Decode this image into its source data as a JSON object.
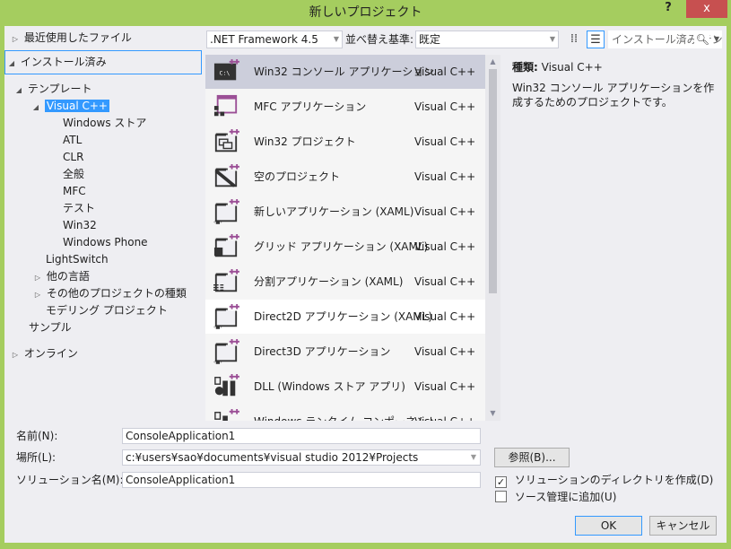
{
  "window": {
    "title": "新しいプロジェクト",
    "help_label": "?",
    "close_label": "x"
  },
  "tree": {
    "recent": "最近使用したファイル",
    "installed": "インストール済み",
    "templates": "テンプレート",
    "visual_cpp": "Visual C++",
    "cpp_children": [
      "Windows ストア",
      "ATL",
      "CLR",
      "全般",
      "MFC",
      "テスト",
      "Win32",
      "Windows Phone"
    ],
    "lightswitch": "LightSwitch",
    "other_languages": "他の言語",
    "other_project_types": "その他のプロジェクトの種類",
    "modeling_projects": "モデリング プロジェクト",
    "samples": "サンプル",
    "online": "オンライン"
  },
  "toolbar": {
    "framework": ".NET Framework 4.5",
    "sort_label": "並べ替え基準:",
    "sort_value": "既定",
    "search_placeholder": "インストール済み テンプレートの検索"
  },
  "templates": [
    {
      "name": "Win32 コンソール アプリケーション",
      "lang": "Visual C++",
      "icon": "console-app-icon",
      "state": "selected"
    },
    {
      "name": "MFC アプリケーション",
      "lang": "Visual C++",
      "icon": "mfc-app-icon",
      "state": ""
    },
    {
      "name": "Win32 プロジェクト",
      "lang": "Visual C++",
      "icon": "win32-project-icon",
      "state": ""
    },
    {
      "name": "空のプロジェクト",
      "lang": "Visual C++",
      "icon": "empty-project-icon",
      "state": ""
    },
    {
      "name": "新しいアプリケーション (XAML)",
      "lang": "Visual C++",
      "icon": "xaml-app-icon",
      "state": ""
    },
    {
      "name": "グリッド アプリケーション (XAML)",
      "lang": "Visual C++",
      "icon": "grid-app-icon",
      "state": ""
    },
    {
      "name": "分割アプリケーション (XAML)",
      "lang": "Visual C++",
      "icon": "split-app-icon",
      "state": ""
    },
    {
      "name": "Direct2D アプリケーション (XAML)",
      "lang": "Visual C++",
      "icon": "direct2d-app-icon",
      "state": "hover"
    },
    {
      "name": "Direct3D アプリケーション",
      "lang": "Visual C++",
      "icon": "direct3d-app-icon",
      "state": ""
    },
    {
      "name": "DLL (Windows ストア アプリ)",
      "lang": "Visual C++",
      "icon": "dll-icon",
      "state": ""
    },
    {
      "name": "Windows ランタイム コンポーネント",
      "lang": "Visual C++",
      "icon": "winrt-component-icon",
      "state": ""
    }
  ],
  "description": {
    "kind_label": "種類:",
    "kind_value": "Visual C++",
    "text": "Win32 コンソール アプリケーションを作成するためのプロジェクトです。"
  },
  "form": {
    "name_label": "名前(N):",
    "name_value": "ConsoleApplication1",
    "location_label": "場所(L):",
    "location_value": "c:¥users¥sao¥documents¥visual studio 2012¥Projects",
    "solution_label": "ソリューション名(M):",
    "solution_value": "ConsoleApplication1",
    "browse_label": "参照(B)...",
    "create_dir_label": "ソリューションのディレクトリを作成(D)",
    "create_dir_checked": true,
    "add_source_label": "ソース管理に追加(U)",
    "add_source_checked": false,
    "ok_label": "OK",
    "cancel_label": "キャンセル"
  }
}
